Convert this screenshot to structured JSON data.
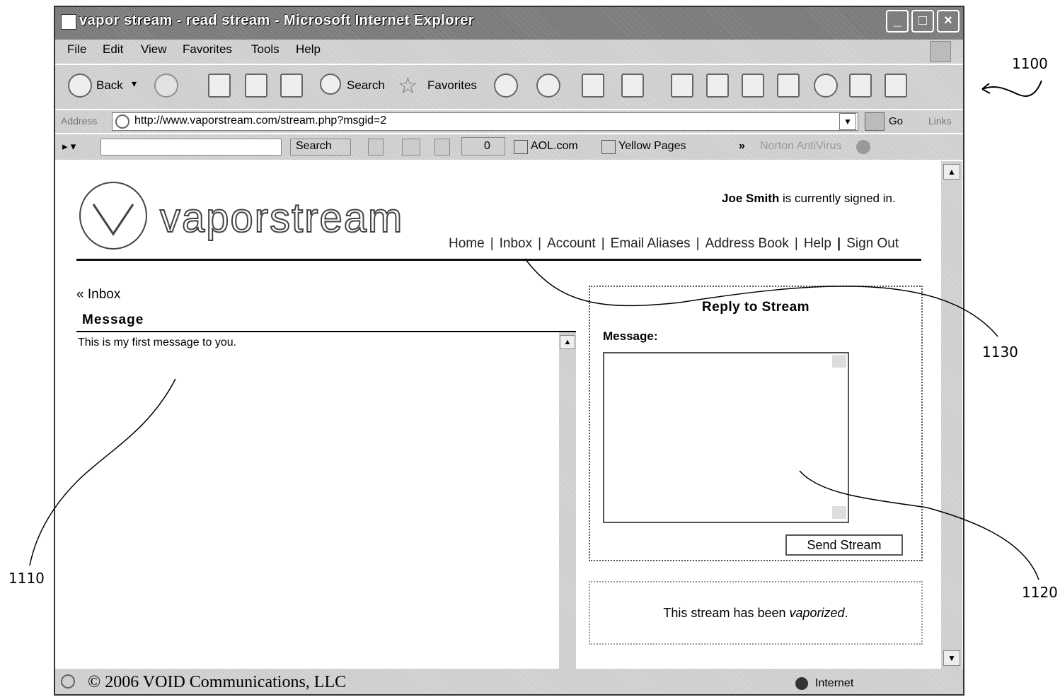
{
  "window": {
    "title": "vapor stream - read stream - Microsoft Internet Explorer",
    "controls": [
      "_",
      "□",
      "×"
    ]
  },
  "menu": [
    "File",
    "Edit",
    "View",
    "Favorites",
    "Tools",
    "Help"
  ],
  "toolbar": {
    "back_label": "Back",
    "search_label": "Search",
    "favorites_label": "Favorites"
  },
  "addressbar": {
    "label": "Address",
    "url": "http://www.vaporstream.com/stream.php?msgid=2",
    "go_label": "Go",
    "links_label": "Links"
  },
  "aol_toolbar": {
    "search_label": "Search",
    "mail_count": "0",
    "aol_link": "AOL.com",
    "yellow_pages": "Yellow Pages",
    "more": "»",
    "antivirus": "Norton AntiVirus"
  },
  "site": {
    "logo": "vaporstream",
    "signed_in_user": "Joe Smith",
    "signed_in_suffix": "is currently signed in.",
    "nav": [
      "Home",
      "Inbox",
      "Account",
      "Email Aliases",
      "Address Book",
      "Help",
      "Sign Out"
    ]
  },
  "message": {
    "back_link": "« Inbox",
    "heading": "Message",
    "body": "This is my first message to you."
  },
  "reply": {
    "title": "Reply to Stream",
    "label": "Message:",
    "textarea_value": "",
    "send_label": "Send Stream"
  },
  "vapor_notice": {
    "prefix": "This stream has been ",
    "emphasis": "vaporized",
    "suffix": "."
  },
  "statusbar": {
    "copyright": "© 2006 VOID Communications, LLC",
    "zone": "Internet"
  },
  "annotations": {
    "figure": "1100",
    "message_area": "1110",
    "reply_area": "1120",
    "nav_bar": "1130"
  }
}
